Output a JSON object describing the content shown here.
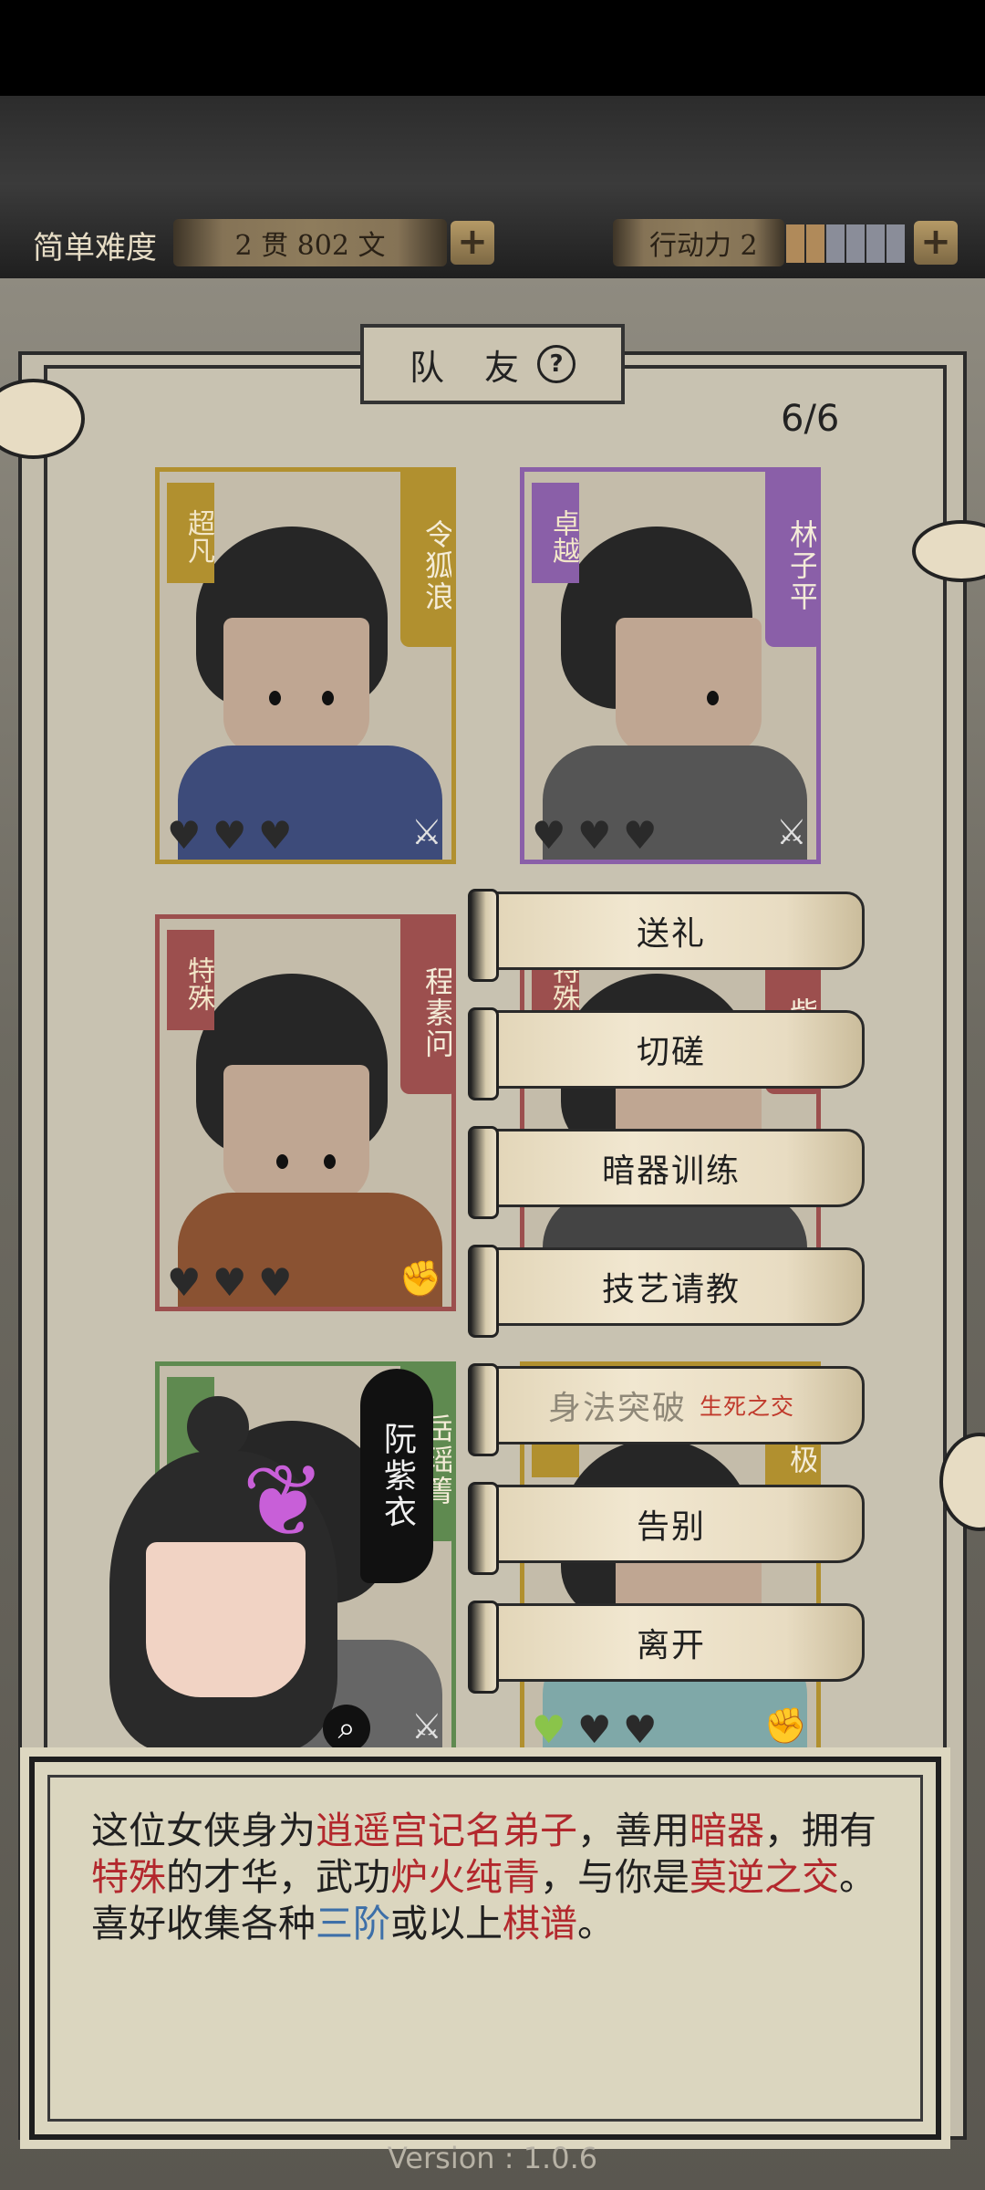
{
  "hud": {
    "difficulty": "简单难度",
    "money": "2 贯 802 文",
    "plus": "+",
    "action_label": "行动力 2",
    "stamina_colors": [
      "#b08a5a",
      "#b08a5a",
      "#8a8d99",
      "#8a8d99",
      "#8a8d99",
      "#8a8d99"
    ]
  },
  "panel": {
    "title": "队 友",
    "help": "?",
    "count": "6/6"
  },
  "cards": [
    {
      "tag": "超凡",
      "name": "令狐浪",
      "color": "#b1902f"
    },
    {
      "tag": "卓越",
      "name": "林子平",
      "color": "#8a5fa8"
    },
    {
      "tag": "特殊",
      "name": "程素问",
      "color": "#9c4f4e"
    },
    {
      "tag": "特殊",
      "name": "紫",
      "color": "#9c4f4e"
    },
    {
      "tag": "良",
      "name": "岳瑶箐",
      "color": "#5f8a50"
    },
    {
      "tag": "凡",
      "name": "极",
      "color": "#b1902f"
    }
  ],
  "menu": {
    "gift": "送礼",
    "spar": "切磋",
    "hidden_weapon": "暗器训练",
    "skill": "技艺请教",
    "movement": "身法突破",
    "movement_note": "生死之交",
    "farewell": "告别",
    "leave": "离开"
  },
  "speaker": {
    "name": "阮紫衣"
  },
  "dialog": {
    "p1": "这位女侠身为",
    "sect": "逍遥宫记名弟子",
    "p2": "，善用",
    "weapon": "暗器",
    "p3": "，拥有",
    "talent": "特殊",
    "p4": "的才华，武功",
    "skill": "炉火纯青",
    "p5": "，与你是",
    "relation": "莫逆之交",
    "p6": "。喜好收集各种",
    "tier": "三阶",
    "p7": "或以上",
    "item": "棋谱",
    "p8": "。"
  },
  "version": "Version : 1.0.6"
}
